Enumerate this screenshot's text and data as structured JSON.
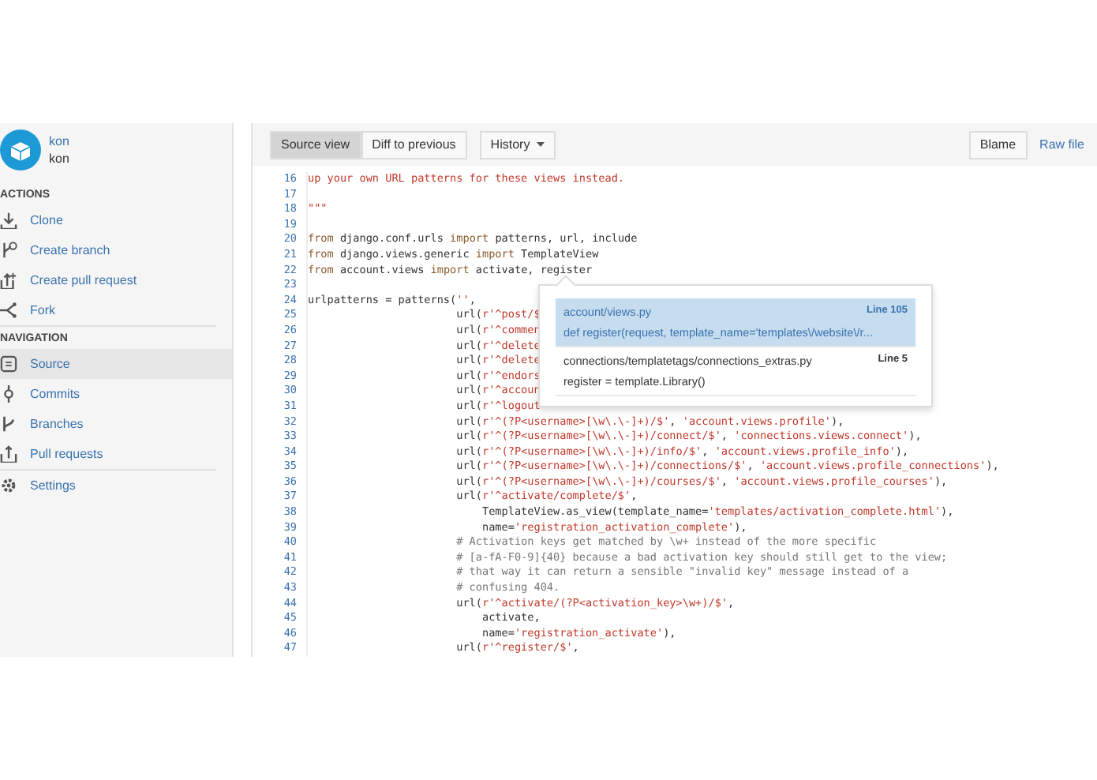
{
  "sidebar": {
    "user": {
      "name": "kon",
      "username": "kon"
    },
    "sections": [
      {
        "title": "ACTIONS",
        "items": [
          {
            "label": "Clone",
            "kind": "clone",
            "selected": false
          },
          {
            "label": "Create branch",
            "kind": "branch-add",
            "selected": false
          },
          {
            "label": "Create pull request",
            "kind": "pr-add",
            "selected": false
          },
          {
            "label": "Fork",
            "kind": "fork",
            "selected": false
          }
        ]
      },
      {
        "title": "NAVIGATION",
        "items": [
          {
            "label": "Source",
            "kind": "source",
            "selected": true
          },
          {
            "label": "Commits",
            "kind": "commit",
            "selected": false
          },
          {
            "label": "Branches",
            "kind": "branch",
            "selected": false
          },
          {
            "label": "Pull requests",
            "kind": "pr",
            "selected": false
          }
        ]
      },
      {
        "items": [
          {
            "label": "Settings",
            "kind": "gear",
            "selected": false
          }
        ]
      }
    ]
  },
  "toolbar": {
    "view_tabs": [
      {
        "label": "Source view",
        "selected": true
      },
      {
        "label": "Diff to previous",
        "selected": false
      }
    ],
    "history": "History",
    "blame": "Blame",
    "raw_file": "Raw file"
  },
  "code": {
    "lines": [
      {
        "number": "16",
        "tokens": [
          {
            "kind": "string",
            "text": "up your own URL patterns for these views instead."
          }
        ]
      },
      {
        "number": "17"
      },
      {
        "number": "18",
        "tokens": [
          {
            "kind": "string",
            "text": "\"\"\""
          }
        ]
      },
      {
        "number": "19"
      },
      {
        "number": "20",
        "tokens": [
          {
            "kind": "keyword",
            "text": "from"
          },
          {
            "kind": "plain",
            "text": " django.conf.urls "
          },
          {
            "kind": "keyword",
            "text": "import"
          },
          {
            "kind": "plain",
            "text": " patterns, url, include"
          }
        ]
      },
      {
        "number": "21",
        "tokens": [
          {
            "kind": "keyword",
            "text": "from"
          },
          {
            "kind": "plain",
            "text": " django.views.generic "
          },
          {
            "kind": "keyword",
            "text": "import"
          },
          {
            "kind": "plain",
            "text": " TemplateView"
          }
        ]
      },
      {
        "number": "22",
        "tokens": [
          {
            "kind": "keyword",
            "text": "from"
          },
          {
            "kind": "plain",
            "text": " account.views "
          },
          {
            "kind": "keyword",
            "text": "import"
          },
          {
            "kind": "plain",
            "text": " activate, register"
          }
        ]
      },
      {
        "number": "23"
      },
      {
        "number": "24",
        "tokens": [
          {
            "kind": "plain",
            "text": "urlpatterns = patterns("
          },
          {
            "kind": "string",
            "text": "''"
          },
          {
            "kind": "plain",
            "text": ","
          }
        ]
      },
      {
        "number": "25",
        "tokens": [
          {
            "kind": "plain",
            "text": "                       url("
          },
          {
            "kind": "string",
            "text": "r'^post/$"
          }
        ]
      },
      {
        "number": "26",
        "tokens": [
          {
            "kind": "plain",
            "text": "                       url("
          },
          {
            "kind": "string",
            "text": "r'^commen"
          }
        ]
      },
      {
        "number": "27",
        "tokens": [
          {
            "kind": "plain",
            "text": "                       url("
          },
          {
            "kind": "string",
            "text": "r'^delete"
          }
        ]
      },
      {
        "number": "28",
        "tokens": [
          {
            "kind": "plain",
            "text": "                       url("
          },
          {
            "kind": "string",
            "text": "r'^delete"
          }
        ]
      },
      {
        "number": "29",
        "tokens": [
          {
            "kind": "plain",
            "text": "                       url("
          },
          {
            "kind": "string",
            "text": "r'^endors"
          }
        ]
      },
      {
        "number": "30",
        "tokens": [
          {
            "kind": "plain",
            "text": "                       url("
          },
          {
            "kind": "string",
            "text": "r'^accoun"
          }
        ]
      },
      {
        "number": "31",
        "tokens": [
          {
            "kind": "plain",
            "text": "                       url("
          },
          {
            "kind": "string",
            "text": "r'^logout"
          }
        ]
      },
      {
        "number": "32",
        "tokens": [
          {
            "kind": "plain",
            "text": "                       url("
          },
          {
            "kind": "string",
            "text": "r'^(?P<username>[\\w\\.\\-]+)/$'"
          },
          {
            "kind": "plain",
            "text": ", "
          },
          {
            "kind": "string",
            "text": "'account.views.profile'"
          },
          {
            "kind": "plain",
            "text": "),"
          }
        ]
      },
      {
        "number": "33",
        "tokens": [
          {
            "kind": "plain",
            "text": "                       url("
          },
          {
            "kind": "string",
            "text": "r'^(?P<username>[\\w\\.\\-]+)/connect/$'"
          },
          {
            "kind": "plain",
            "text": ", "
          },
          {
            "kind": "string",
            "text": "'connections.views.connect'"
          },
          {
            "kind": "plain",
            "text": "),"
          }
        ]
      },
      {
        "number": "34",
        "tokens": [
          {
            "kind": "plain",
            "text": "                       url("
          },
          {
            "kind": "string",
            "text": "r'^(?P<username>[\\w\\.\\-]+)/info/$'"
          },
          {
            "kind": "plain",
            "text": ", "
          },
          {
            "kind": "string",
            "text": "'account.views.profile_info'"
          },
          {
            "kind": "plain",
            "text": "),"
          }
        ]
      },
      {
        "number": "35",
        "tokens": [
          {
            "kind": "plain",
            "text": "                       url("
          },
          {
            "kind": "string",
            "text": "r'^(?P<username>[\\w\\.\\-]+)/connections/$'"
          },
          {
            "kind": "plain",
            "text": ", "
          },
          {
            "kind": "string",
            "text": "'account.views.profile_connections'"
          },
          {
            "kind": "plain",
            "text": "),"
          }
        ]
      },
      {
        "number": "36",
        "tokens": [
          {
            "kind": "plain",
            "text": "                       url("
          },
          {
            "kind": "string",
            "text": "r'^(?P<username>[\\w\\.\\-]+)/courses/$'"
          },
          {
            "kind": "plain",
            "text": ", "
          },
          {
            "kind": "string",
            "text": "'account.views.profile_courses'"
          },
          {
            "kind": "plain",
            "text": "),"
          }
        ]
      },
      {
        "number": "37",
        "tokens": [
          {
            "kind": "plain",
            "text": "                       url("
          },
          {
            "kind": "string",
            "text": "r'^activate/complete/$'"
          },
          {
            "kind": "plain",
            "text": ","
          }
        ]
      },
      {
        "number": "38",
        "tokens": [
          {
            "kind": "plain",
            "text": "                           TemplateView.as_view(template_name="
          },
          {
            "kind": "string",
            "text": "'templates/activation_complete.html'"
          },
          {
            "kind": "plain",
            "text": "),"
          }
        ]
      },
      {
        "number": "39",
        "tokens": [
          {
            "kind": "plain",
            "text": "                           name="
          },
          {
            "kind": "string",
            "text": "'registration_activation_complete'"
          },
          {
            "kind": "plain",
            "text": "),"
          }
        ]
      },
      {
        "number": "40",
        "tokens": [
          {
            "kind": "comment",
            "text": "                       # Activation keys get matched by \\w+ instead of the more specific"
          }
        ]
      },
      {
        "number": "41",
        "tokens": [
          {
            "kind": "comment",
            "text": "                       # [a-fA-F0-9]{40} because a bad activation key should still get to the view;"
          }
        ]
      },
      {
        "number": "42",
        "tokens": [
          {
            "kind": "comment",
            "text": "                       # that way it can return a sensible \"invalid key\" message instead of a"
          }
        ]
      },
      {
        "number": "43",
        "tokens": [
          {
            "kind": "comment",
            "text": "                       # confusing 404."
          }
        ]
      },
      {
        "number": "44",
        "tokens": [
          {
            "kind": "plain",
            "text": "                       url("
          },
          {
            "kind": "string",
            "text": "r'^activate/(?P<activation_key>\\w+)/$'"
          },
          {
            "kind": "plain",
            "text": ","
          }
        ]
      },
      {
        "number": "45",
        "tokens": [
          {
            "kind": "plain",
            "text": "                           activate,"
          }
        ]
      },
      {
        "number": "46",
        "tokens": [
          {
            "kind": "plain",
            "text": "                           name="
          },
          {
            "kind": "string",
            "text": "'registration_activate'"
          },
          {
            "kind": "plain",
            "text": "),"
          }
        ]
      },
      {
        "number": "47",
        "tokens": [
          {
            "kind": "plain",
            "text": "                       url("
          },
          {
            "kind": "string",
            "text": "r'^register/$'"
          },
          {
            "kind": "plain",
            "text": ","
          }
        ]
      }
    ]
  },
  "popup": {
    "results": [
      {
        "file": "account/views.py",
        "line": "Line 105",
        "snippet": "def register(request, template_name='templates\\/website\\/r...",
        "selected": true
      },
      {
        "file": "connections/templatetags/connections_extras.py",
        "line": "Line 5",
        "snippet": "register = template.Library()",
        "selected": false
      }
    ]
  }
}
